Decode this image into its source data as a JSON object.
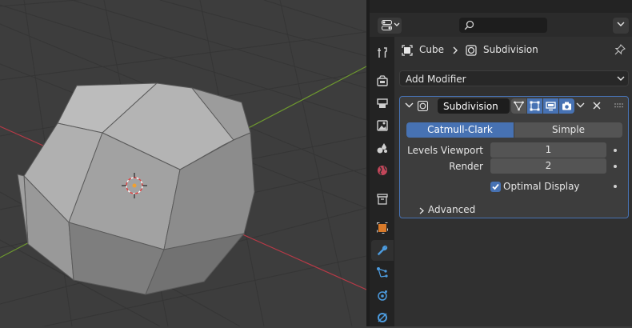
{
  "viewport": {
    "object_name": "Cube"
  },
  "properties": {
    "header": {
      "editor_icon": "properties-editor-icon",
      "search_placeholder": "",
      "search_icon": "search-icon"
    },
    "tabs": [
      {
        "name": "tool",
        "icon": "tool-icon"
      },
      {
        "name": "render",
        "icon": "render-icon"
      },
      {
        "name": "output",
        "icon": "output-icon"
      },
      {
        "name": "view-layer",
        "icon": "view-layer-icon"
      },
      {
        "name": "scene",
        "icon": "scene-icon"
      },
      {
        "name": "world",
        "icon": "world-icon"
      },
      {
        "name": "collection",
        "icon": "collection-icon"
      },
      {
        "name": "object",
        "icon": "object-icon"
      },
      {
        "name": "modifiers",
        "icon": "wrench-icon",
        "active": true
      },
      {
        "name": "particles",
        "icon": "particles-icon"
      },
      {
        "name": "physics",
        "icon": "physics-icon"
      },
      {
        "name": "constraints",
        "icon": "constraints-icon"
      }
    ],
    "breadcrumb": {
      "object": "Cube",
      "modifier": "Subdivision"
    },
    "add_modifier_label": "Add Modifier",
    "modifier": {
      "name": "Subdivision",
      "toggles": [
        "on-cage",
        "edit-mode",
        "viewport",
        "render"
      ],
      "algorithm_options": [
        "Catmull-Clark",
        "Simple"
      ],
      "algorithm_selected": "Catmull-Clark",
      "levels_viewport_label": "Levels Viewport",
      "levels_viewport_value": "1",
      "render_label": "Render",
      "render_value": "2",
      "optimal_display_label": "Optimal Display",
      "optimal_display_checked": true,
      "advanced_label": "Advanced"
    },
    "colors": {
      "accent": "#4772b3",
      "panel_bg": "#3d3d3d",
      "x_axis": "#b83a47",
      "y_axis": "#6e9a2e"
    }
  }
}
